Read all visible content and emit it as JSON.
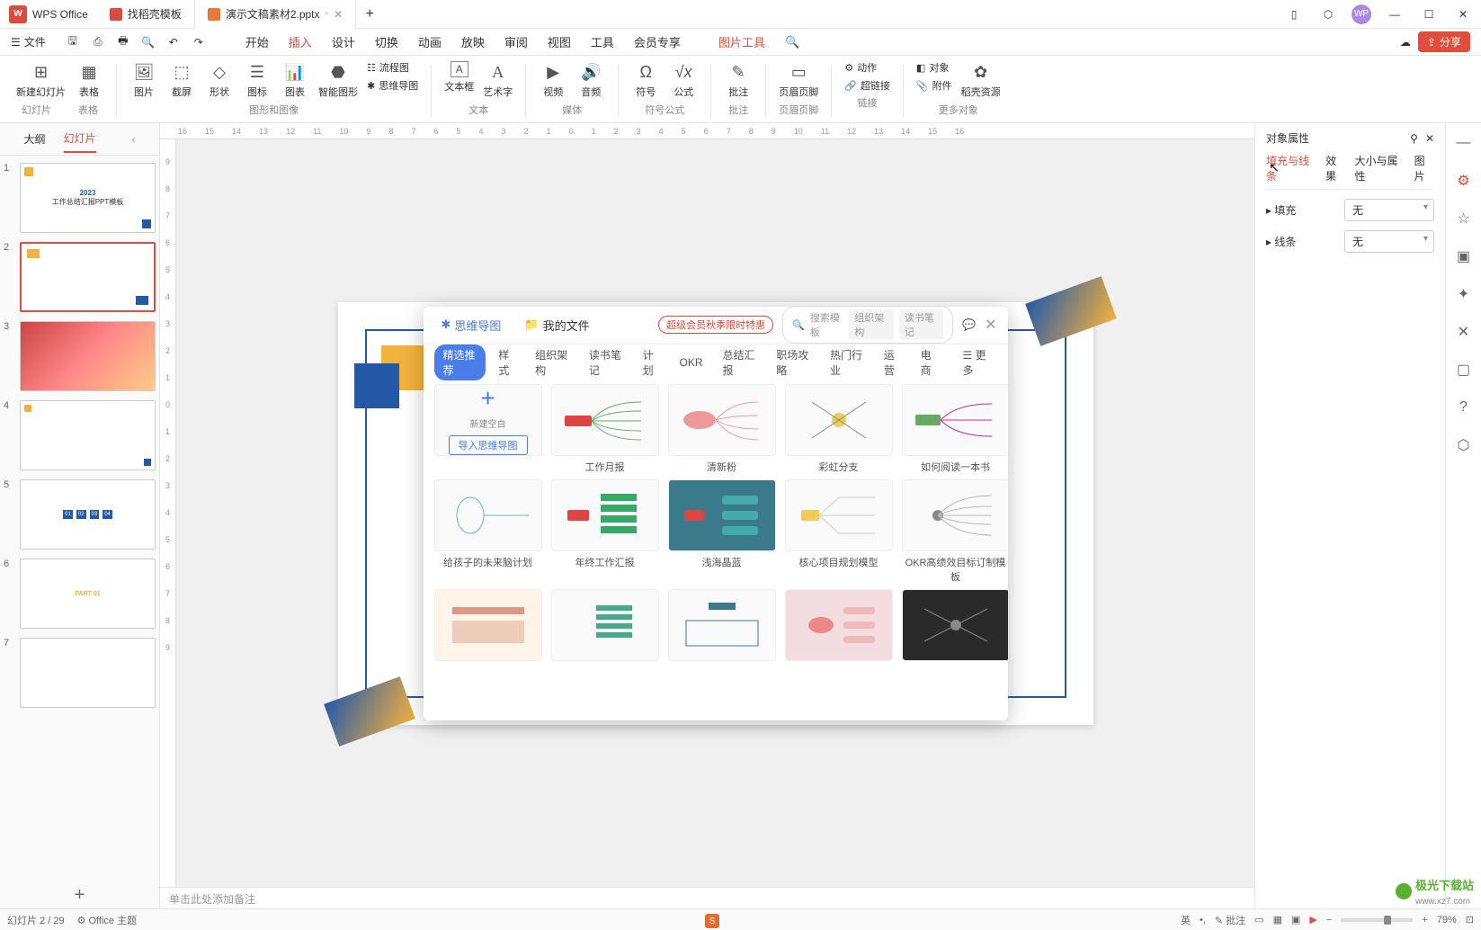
{
  "titlebar": {
    "app_name": "WPS Office",
    "tabs": [
      {
        "label": "找稻壳模板",
        "icon": "red"
      },
      {
        "label": "演示文稿素材2.pptx",
        "icon": "orange"
      }
    ]
  },
  "menubar": {
    "file": "文件",
    "tabs": [
      "开始",
      "插入",
      "设计",
      "切换",
      "动画",
      "放映",
      "审阅",
      "视图",
      "工具",
      "会员专享"
    ],
    "context_tab": "图片工具",
    "share": "分享"
  },
  "ribbon": {
    "groups": [
      {
        "label": "幻灯片",
        "buttons": [
          {
            "label": "新建幻灯片",
            "icon": "⊞"
          },
          {
            "label": "表格",
            "icon": "▦"
          }
        ],
        "second_label": "表格"
      },
      {
        "label": "图形和图像",
        "buttons": [
          {
            "label": "图片",
            "icon": "🖼"
          },
          {
            "label": "截屏",
            "icon": "⬚"
          },
          {
            "label": "形状",
            "icon": "◇"
          },
          {
            "label": "图标",
            "icon": "☰"
          },
          {
            "label": "图表",
            "icon": "📊"
          },
          {
            "label": "智能图形",
            "icon": "⬣"
          },
          {
            "label": "流程图",
            "icon": "↔",
            "small": true
          },
          {
            "label": "思维导图",
            "icon": "✱",
            "small": true
          }
        ]
      },
      {
        "label": "文本",
        "buttons": [
          {
            "label": "文本框",
            "icon": "A"
          },
          {
            "label": "艺术字",
            "icon": "A"
          }
        ]
      },
      {
        "label": "媒体",
        "buttons": [
          {
            "label": "视频",
            "icon": "▶"
          },
          {
            "label": "音频",
            "icon": "🔊"
          }
        ]
      },
      {
        "label": "符号公式",
        "buttons": [
          {
            "label": "符号",
            "icon": "Ω"
          },
          {
            "label": "公式",
            "icon": "√x"
          }
        ]
      },
      {
        "label": "批注",
        "buttons": [
          {
            "label": "批注",
            "icon": "✎"
          }
        ]
      },
      {
        "label": "页眉页脚",
        "buttons": [
          {
            "label": "页眉页脚",
            "icon": "▭"
          }
        ]
      },
      {
        "label": "链接",
        "buttons": [
          {
            "label": "动作",
            "icon": "⚙",
            "small": true
          },
          {
            "label": "超链接",
            "icon": "🔗",
            "small": true
          }
        ]
      },
      {
        "label": "更多对象",
        "buttons": [
          {
            "label": "对象",
            "icon": "◧",
            "small": true
          },
          {
            "label": "附件",
            "icon": "📎",
            "small": true
          },
          {
            "label": "稻壳资源",
            "icon": "✿"
          }
        ]
      }
    ]
  },
  "slide_panel": {
    "tabs": [
      "大纲",
      "幻灯片"
    ],
    "slides": [
      1,
      2,
      3,
      4,
      5,
      6,
      7
    ]
  },
  "notes": "单击此处添加备注",
  "prop_panel": {
    "title": "对象属性",
    "tabs": [
      "填充与线条",
      "效果",
      "大小与属性",
      "图片"
    ],
    "fill": {
      "label": "填充",
      "value": "无"
    },
    "line": {
      "label": "线条",
      "value": "无"
    }
  },
  "dialog": {
    "tab_mind": "思维导图",
    "tab_files": "我的文件",
    "promo": "超级会员秋季限时特惠",
    "search_placeholder": "搜索模板",
    "search_tags": [
      "组织架构",
      "读书笔记"
    ],
    "categories": [
      "精选推荐",
      "样式",
      "组织架构",
      "读书笔记",
      "计划",
      "OKR",
      "总结汇报",
      "职场攻略",
      "热门行业",
      "运营",
      "电商"
    ],
    "more": "更多",
    "blank": "新建空白",
    "import": "导入思维导图",
    "templates_row1": [
      "",
      "工作月报",
      "清新粉",
      "彩虹分支",
      "如何阅读一本书"
    ],
    "templates_row2": [
      "给孩子的未来脑计划",
      "年终工作汇报",
      "浅海晶蓝",
      "核心项目规划模型",
      "OKR高绩效目标订制模板"
    ]
  },
  "statusbar": {
    "slide_info": "幻灯片 2 / 29",
    "theme": "Office 主题",
    "lang": "英",
    "annotate": "批注",
    "zoom": "79%"
  },
  "watermark": {
    "brand": "极光下载站",
    "url": "www.xz7.com"
  },
  "ruler_h": [
    "16",
    "15",
    "14",
    "13",
    "12",
    "11",
    "10",
    "9",
    "8",
    "7",
    "6",
    "5",
    "4",
    "3",
    "2",
    "1",
    "0",
    "1",
    "2",
    "3",
    "4",
    "5",
    "6",
    "7",
    "8",
    "9",
    "10",
    "11",
    "12",
    "13",
    "14",
    "15",
    "16"
  ],
  "ruler_v": [
    "9",
    "8",
    "7",
    "6",
    "5",
    "4",
    "3",
    "2",
    "1",
    "0",
    "1",
    "2",
    "3",
    "4",
    "5",
    "6",
    "7",
    "8",
    "9"
  ]
}
